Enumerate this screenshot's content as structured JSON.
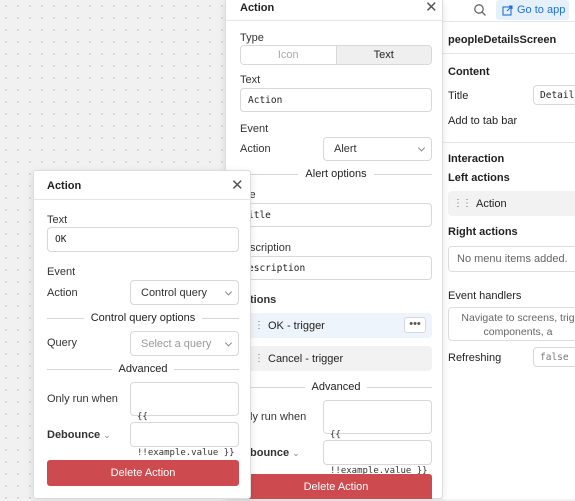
{
  "topbar": {
    "go_to_app_label": "Go to app"
  },
  "right_panel": {
    "screen_name": "peopleDetailsScreen",
    "content_heading": "Content",
    "title_label": "Title",
    "title_value": "Details",
    "add_to_tab_bar": "Add to tab bar",
    "interaction_heading": "Interaction",
    "left_actions": "Left actions",
    "left_action_item": "Action",
    "right_actions": "Right actions",
    "no_menu_items": "No menu items added.",
    "event_handlers": "Event handlers",
    "event_handlers_hint_1": "Navigate to screens, trig",
    "event_handlers_hint_2": "components, a",
    "refreshing_label": "Refreshing",
    "refreshing_value": "false"
  },
  "action_panel_main": {
    "title": "Action",
    "type_label": "Type",
    "type_options": [
      "Icon",
      "Text"
    ],
    "text_label": "Text",
    "text_value": "Action",
    "event_label": "Event",
    "action_label": "Action",
    "action_value": "Alert",
    "alert_options": "Alert options",
    "title_label": "le",
    "title_value": "itle",
    "description_label": "scription",
    "description_value": "escription",
    "options_label": "tions",
    "option_ok": "OK - trigger",
    "option_cancel": "Cancel - trigger",
    "advanced": "Advanced",
    "only_run_when": "ly run when",
    "only_run_code_1": "{{",
    "only_run_code_2": "!!example.value }}",
    "debounce": "bounce",
    "delete_label": "Delete Action"
  },
  "action_panel_front": {
    "title": "Action",
    "text_label": "Text",
    "text_value": "OK",
    "event_label": "Event",
    "action_label": "Action",
    "action_value": "Control query",
    "control_query_options": "Control query options",
    "query_label": "Query",
    "query_placeholder": "Select a query",
    "advanced": "Advanced",
    "only_run_when": "Only run when",
    "only_run_code_1": "{{",
    "only_run_code_2": "!!example.value }}",
    "debounce": "Debounce",
    "delete_label": "Delete Action"
  },
  "colors": {
    "accent": "#1e6fd9",
    "danger": "#cd4a4e",
    "highlight_row": "#eef4fb"
  }
}
